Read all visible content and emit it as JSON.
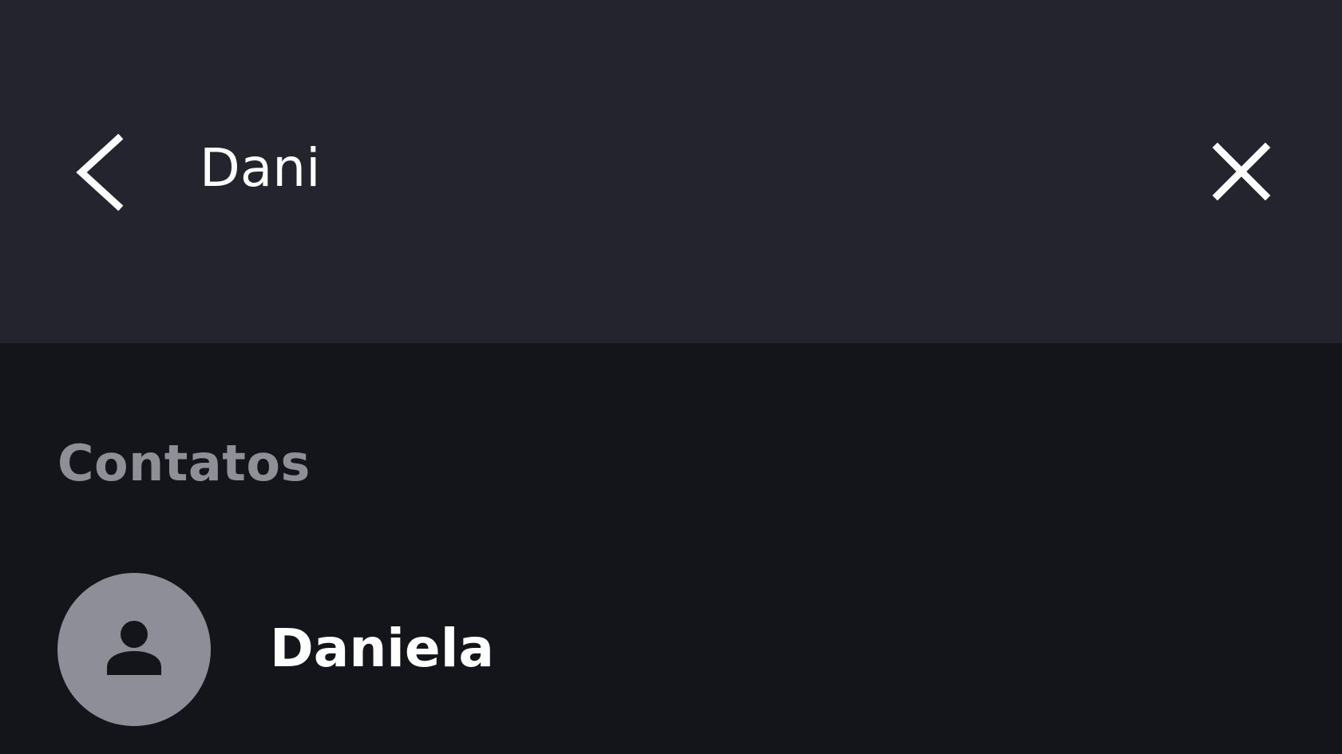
{
  "search": {
    "query": "Dani",
    "back_icon": "chevron-left-icon",
    "clear_icon": "close-icon"
  },
  "results": {
    "section_title": "Contatos",
    "contacts": [
      {
        "name": "Daniela",
        "avatar_icon": "person-icon"
      }
    ]
  },
  "colors": {
    "header_bg": "#24242f",
    "body_bg": "#14151b",
    "section_title": "#8f8f98",
    "avatar_bg": "#8e8e98",
    "text": "#ffffff"
  }
}
